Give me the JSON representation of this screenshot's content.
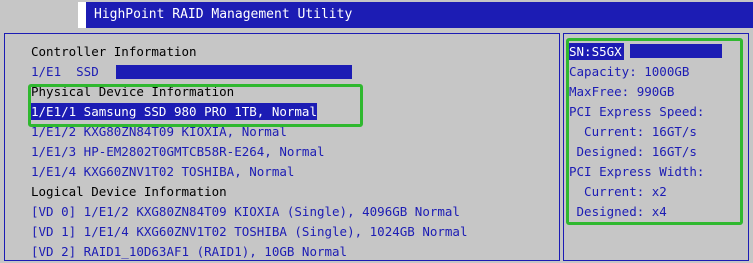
{
  "title": "HighPoint RAID Management Utility",
  "main": {
    "controller_header": "Controller Information",
    "controller_item": "1/E1  SSD",
    "physical_header": "Physical Device Information",
    "physical_devices": [
      "1/E1/1 Samsung SSD 980 PRO 1TB, Normal",
      "1/E1/2 KXG80ZN84T09 KIOXIA, Normal",
      "1/E1/3 HP-EM2802T0GMTCB58R-E264, Normal",
      "1/E1/4 KXG60ZNV1T02 TOSHIBA, Normal"
    ],
    "logical_header": "Logical Device Information",
    "logical_devices": [
      "[VD 0] 1/E1/2 KXG80ZN84T09 KIOXIA (Single), 4096GB Normal",
      "[VD 1] 1/E1/4 KXG60ZNV1T02 TOSHIBA (Single), 1024GB Normal",
      "[VD 2] RAID1_10D63AF1 (RAID1), 10GB Normal"
    ]
  },
  "side": {
    "sn_label": "SN:S5GX",
    "capacity": "Capacity: 1000GB",
    "maxfree": "MaxFree: 990GB",
    "pci_speed_header": "PCI Express Speed:",
    "speed_current": "  Current: 16GT/s",
    "speed_designed": " Designed: 16GT/s",
    "pci_width_header": "PCI Express Width:",
    "width_current": "  Current: x2",
    "width_designed": " Designed: x4"
  },
  "colors": {
    "background": "#c6c6c6",
    "accent_blue": "#1c1cb4",
    "highlight_green": "#2fb82f",
    "text_white": "#ffffff"
  }
}
